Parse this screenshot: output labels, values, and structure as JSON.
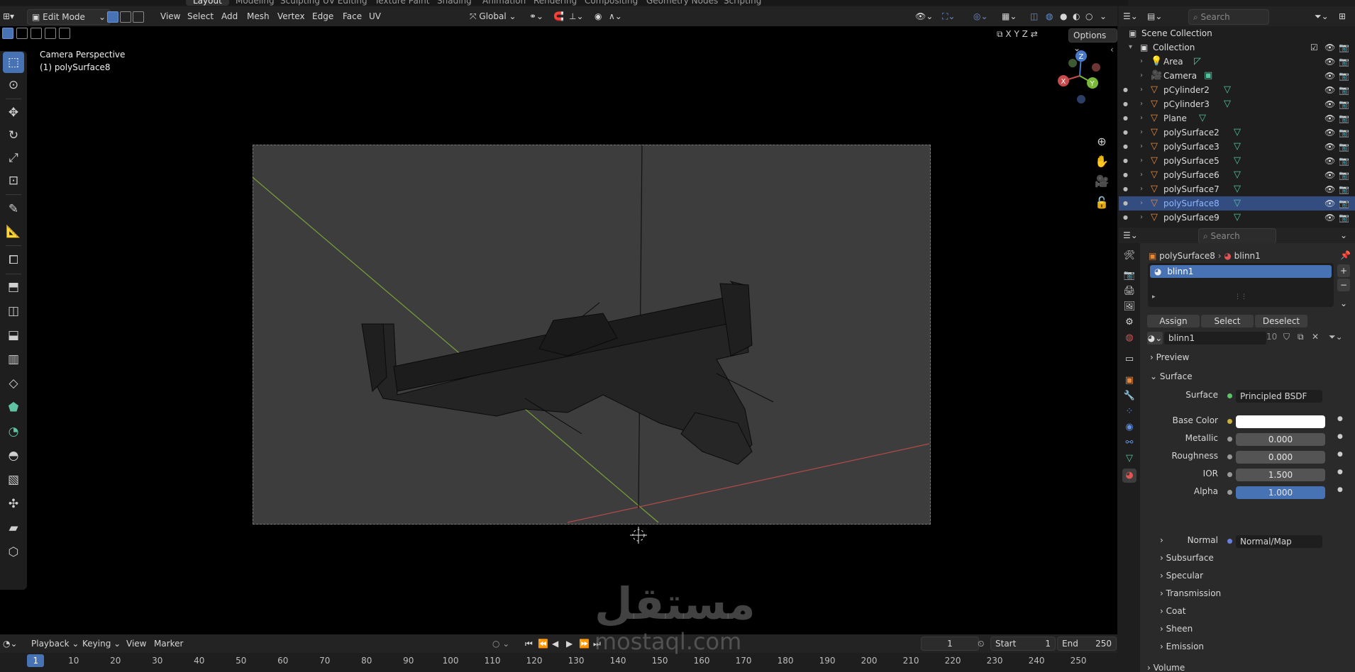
{
  "workspace_tabs": [
    "Layout",
    "Modeling",
    "Sculpting",
    "UV Editing",
    "Texture Paint",
    "Shading",
    "Animation",
    "Rendering",
    "Compositing",
    "Geometry Nodes",
    "Scripting"
  ],
  "viewport_header": {
    "mode": "Edit Mode",
    "menus": [
      "View",
      "Select",
      "Add",
      "Mesh",
      "Vertex",
      "Edge",
      "Face",
      "UV"
    ],
    "orientation": "Global",
    "axis_lock": [
      "X",
      "Y",
      "Z"
    ],
    "options_label": "Options"
  },
  "viewport": {
    "camera_label": "Camera Perspective",
    "object_label": "(1) polySurface8"
  },
  "gizmo": {
    "x": "X",
    "y": "Y",
    "z": "Z"
  },
  "outliner": {
    "search_placeholder": "Search",
    "scene_collection": "Scene Collection",
    "collection": "Collection",
    "items": [
      {
        "name": "Area",
        "icon": "light-icon"
      },
      {
        "name": "Camera",
        "icon": "camera-icon"
      },
      {
        "name": "pCylinder2",
        "icon": "mesh-icon"
      },
      {
        "name": "pCylinder3",
        "icon": "mesh-icon"
      },
      {
        "name": "Plane",
        "icon": "mesh-icon"
      },
      {
        "name": "polySurface2",
        "icon": "mesh-icon"
      },
      {
        "name": "polySurface3",
        "icon": "mesh-icon"
      },
      {
        "name": "polySurface5",
        "icon": "mesh-icon"
      },
      {
        "name": "polySurface6",
        "icon": "mesh-icon"
      },
      {
        "name": "polySurface7",
        "icon": "mesh-icon"
      },
      {
        "name": "polySurface8",
        "icon": "mesh-icon",
        "selected": true
      },
      {
        "name": "polySurface9",
        "icon": "mesh-icon"
      }
    ]
  },
  "properties": {
    "search_placeholder": "Search",
    "breadcrumb_object": "polySurface8",
    "breadcrumb_material": "blinn1",
    "slot_name": "blinn1",
    "assign_label": "Assign",
    "select_label": "Select",
    "deselect_label": "Deselect",
    "material_name": "blinn1",
    "user_count": "10",
    "preview_label": "Preview",
    "surface_section": "Surface",
    "surface_label": "Surface",
    "surface_value": "Principled BSDF",
    "fields": [
      {
        "label": "Base Color",
        "value": ""
      },
      {
        "label": "Metallic",
        "value": "0.000"
      },
      {
        "label": "Roughness",
        "value": "0.000"
      },
      {
        "label": "IOR",
        "value": "1.500"
      },
      {
        "label": "Alpha",
        "value": "1.000"
      }
    ],
    "normal_label": "Normal",
    "normal_value": "Normal/Map",
    "subsections": [
      "Subsurface",
      "Specular",
      "Transmission",
      "Coat",
      "Sheen",
      "Emission"
    ],
    "volume_label": "Volume",
    "colors": {
      "accent": "#4772b3",
      "base_color": "#ffffff",
      "alpha_fill": "#4772b3"
    }
  },
  "timeline": {
    "menus": [
      "Playback",
      "Keying",
      "View",
      "Marker"
    ],
    "current_frame": "1",
    "start_label": "Start",
    "start_value": "1",
    "end_label": "End",
    "end_value": "250",
    "ticks": [
      "1",
      "10",
      "20",
      "30",
      "40",
      "50",
      "60",
      "70",
      "80",
      "90",
      "100",
      "110",
      "120",
      "130",
      "140",
      "150",
      "160",
      "170",
      "180",
      "190",
      "200",
      "210",
      "220",
      "230",
      "240",
      "250"
    ]
  },
  "watermark": {
    "arabic": "مستقل",
    "latin": "mostaql.com"
  }
}
